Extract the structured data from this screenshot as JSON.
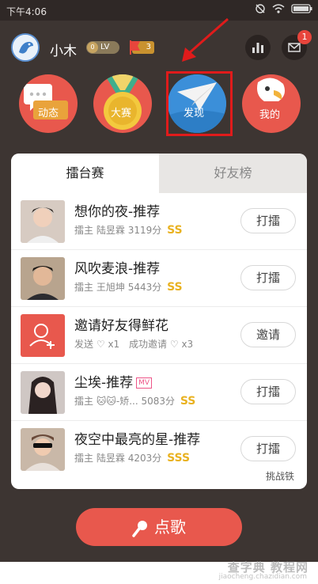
{
  "status": {
    "time": "下午4:06"
  },
  "user": {
    "name": "小木",
    "level": "LV",
    "level_num": "0",
    "badge_count": "3"
  },
  "header": {
    "message_count": "1"
  },
  "nav": [
    {
      "label": "动态",
      "color": "#e8584d"
    },
    {
      "label": "大赛",
      "color": "#e8584d"
    },
    {
      "label": "发现",
      "color": "#3b8fd9"
    },
    {
      "label": "我的",
      "color": "#e8584d"
    }
  ],
  "tabs": [
    {
      "label": "擂台赛"
    },
    {
      "label": "好友榜"
    }
  ],
  "rows": [
    {
      "title": "想你的夜-推荐",
      "role": "擂主",
      "host": "陆昱霖",
      "score": "3119分",
      "grade": "SS",
      "button": "打擂"
    },
    {
      "title": "风吹麦浪-推荐",
      "role": "擂主",
      "host": "王旭坤",
      "score": "5443分",
      "grade": "SS",
      "button": "打擂"
    },
    {
      "title": "邀请好友得鲜花",
      "send": "发送",
      "send_count": "x1",
      "success": "成功邀请",
      "success_count": "x3",
      "button": "邀请"
    },
    {
      "title": "尘埃-推荐",
      "tag": "MV",
      "role": "擂主",
      "host": "🐱🐱-矫...",
      "score": "5083分",
      "grade": "SS",
      "button": "打擂"
    },
    {
      "title": "夜空中最亮的星-推荐",
      "role": "擂主",
      "host": "陆昱霖",
      "score": "4203分",
      "grade": "SSS",
      "button": "打擂"
    }
  ],
  "footer": {
    "challenge_link": "挑战铁"
  },
  "song_button": {
    "label": "点歌"
  },
  "watermark": {
    "line1": "查字典 教程网",
    "line2": "jiaocheng.chazidian.com"
  }
}
